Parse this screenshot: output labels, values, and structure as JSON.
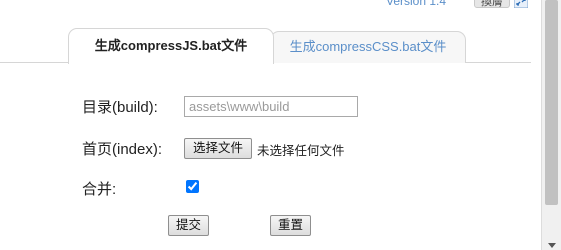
{
  "header": {
    "version_text": "Version 1.4",
    "top_button_label": "換膚"
  },
  "tabs": [
    {
      "label": "生成compressJS.bat文件",
      "active": true
    },
    {
      "label": "生成compressCSS.bat文件",
      "active": false
    }
  ],
  "form": {
    "build": {
      "label": "目录(build):",
      "placeholder": "assets\\www\\build",
      "value": ""
    },
    "index": {
      "label": "首页(index):",
      "file_button_label": "选择文件",
      "file_status": "未选择任何文件"
    },
    "merge": {
      "label": "合并:",
      "checked": true
    },
    "submit_label": "提交",
    "reset_label": "重置"
  }
}
